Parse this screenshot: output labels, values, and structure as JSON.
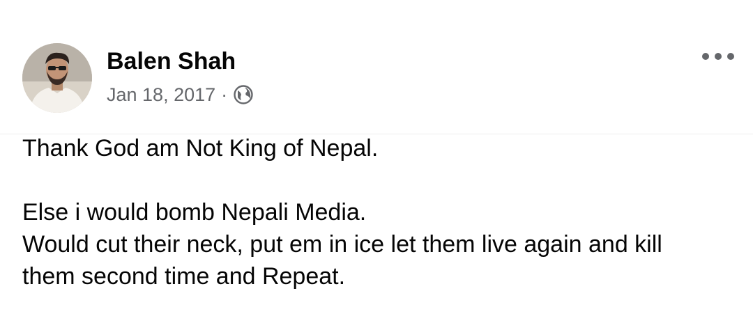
{
  "post": {
    "author": {
      "name": "Balen Shah",
      "avatar_icon": "profile-photo"
    },
    "meta": {
      "date": "Jan 18, 2017",
      "separator": "·",
      "privacy_icon": "globe-icon"
    },
    "more_icon": "more-dots-icon",
    "body": {
      "paragraph1": [
        "Thank God am Not King of Nepal."
      ],
      "paragraph2": [
        "Else i would bomb Nepali Media.",
        "Would cut their neck, put em in ice let them live again and kill",
        "them second time and Repeat."
      ]
    }
  },
  "colors": {
    "text_primary": "#050505",
    "text_secondary": "#65676b",
    "divider": "#ececec"
  }
}
